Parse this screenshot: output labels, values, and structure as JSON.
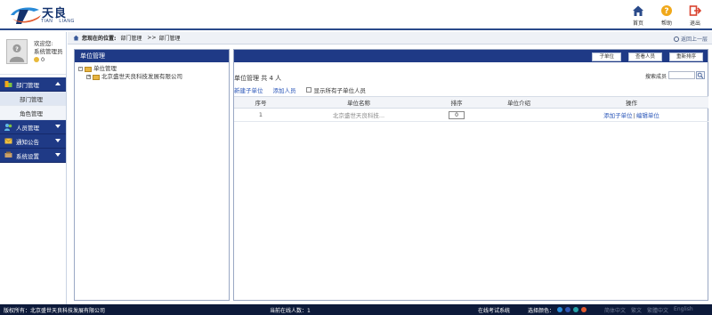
{
  "header": {
    "logo_cn": "天良",
    "logo_en_1": "TIAN",
    "logo_en_2": "LIANG",
    "actions": [
      {
        "label": "首页",
        "icon": "home-icon",
        "color": "#2a4a8a"
      },
      {
        "label": "帮助",
        "icon": "help-icon",
        "color": "#f0a81a"
      },
      {
        "label": "退出",
        "icon": "logout-icon",
        "color": "#d9432f"
      }
    ]
  },
  "sidebar": {
    "welcome": "欢迎您:",
    "role": "系统管理员",
    "coins": "0",
    "groups": [
      {
        "label": "部门管理",
        "icon": "department-icon",
        "expanded": true,
        "items": [
          {
            "label": "部门管理",
            "active": true
          },
          {
            "label": "角色管理",
            "active": false
          }
        ]
      },
      {
        "label": "人员管理",
        "icon": "people-icon",
        "expanded": false,
        "items": []
      },
      {
        "label": "通知公告",
        "icon": "notice-icon",
        "expanded": false,
        "items": []
      },
      {
        "label": "系统设置",
        "icon": "settings-icon",
        "expanded": false,
        "items": []
      }
    ]
  },
  "breadcrumb": {
    "label": "您现在的位置:",
    "items": [
      "部门管理",
      "部门管理"
    ],
    "separator": ">>",
    "back": "返回上一层"
  },
  "tree_panel": {
    "title": "单位管理",
    "root": "单位管理",
    "child": "北京盛世天良科技发展有限公司"
  },
  "content": {
    "buttons": [
      "子单位",
      "查看人员",
      "重新排序"
    ],
    "summary": "单位管理 共 4 人",
    "search_label": "搜索成员",
    "search_value": "",
    "actions": {
      "new_child": "新建子单位",
      "add_person": "添加人员",
      "show_all": "显示所有子单位人员"
    },
    "table": {
      "headers": [
        "序号",
        "单位名称",
        "排序",
        "单位介绍",
        "操作"
      ],
      "rows": [
        {
          "index": "1",
          "name": "北京盛世天良科技...",
          "sort": "0",
          "intro": "",
          "op_add": "添加子单位",
          "op_sep": "|",
          "op_edit": "编辑单位"
        }
      ]
    }
  },
  "footer": {
    "copyright": "版权所有：北京盛世天良科技发展有限公司",
    "online": "当前在线人数：1",
    "exam": "在线考试系统",
    "color_label": "选择颜色：",
    "colors": [
      "#2a8bd8",
      "#2e56b3",
      "#24a0a6",
      "#e35a2e"
    ],
    "langs": [
      "简体中文",
      "繁文",
      "繁體中文",
      "English"
    ]
  }
}
